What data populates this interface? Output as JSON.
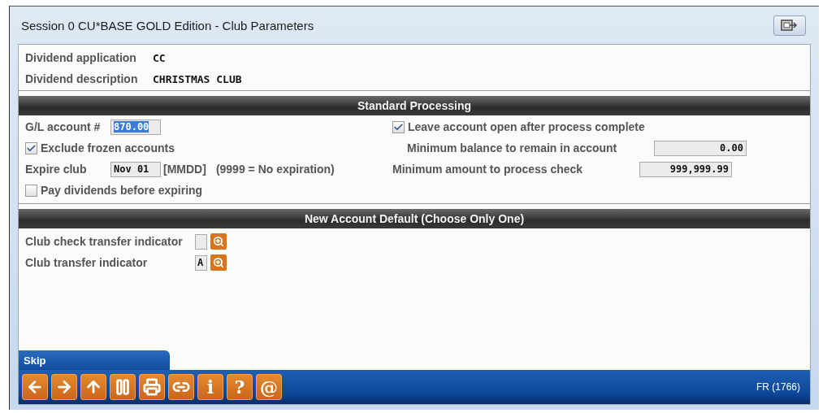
{
  "window": {
    "title": "Session 0 CU*BASE GOLD Edition - Club Parameters"
  },
  "header": [
    {
      "label": "Dividend application",
      "value": "CC"
    },
    {
      "label": "Dividend description",
      "value": "CHRISTMAS CLUB"
    }
  ],
  "standard_processing": {
    "title": "Standard Processing",
    "gl_account": {
      "label": "G/L account #",
      "value": "870.00",
      "selected": true
    },
    "exclude_frozen": {
      "label": "Exclude frozen accounts",
      "checked": true
    },
    "expire_club": {
      "label": "Expire club",
      "value": "Nov 01",
      "format": "[MMDD]",
      "hint": "(9999 = No expiration)"
    },
    "pay_dividends": {
      "label": "Pay dividends before expiring",
      "checked": false
    },
    "leave_open": {
      "label": "Leave account open after process complete",
      "checked": true
    },
    "min_balance": {
      "label": "Minimum balance to remain in account",
      "value": "0.00"
    },
    "min_amount": {
      "label": "Minimum amount to process check",
      "value": "999,999.99"
    }
  },
  "new_account_default": {
    "title": "New Account Default (Choose Only One)",
    "rows": [
      {
        "label": "Club check transfer indicator",
        "value": ""
      },
      {
        "label": "Club transfer indicator",
        "value": "A"
      }
    ]
  },
  "action_tab": "Skip",
  "toolbar": {
    "glyphs": [
      "i",
      "?",
      "@"
    ],
    "status": "FR (1766)"
  }
}
